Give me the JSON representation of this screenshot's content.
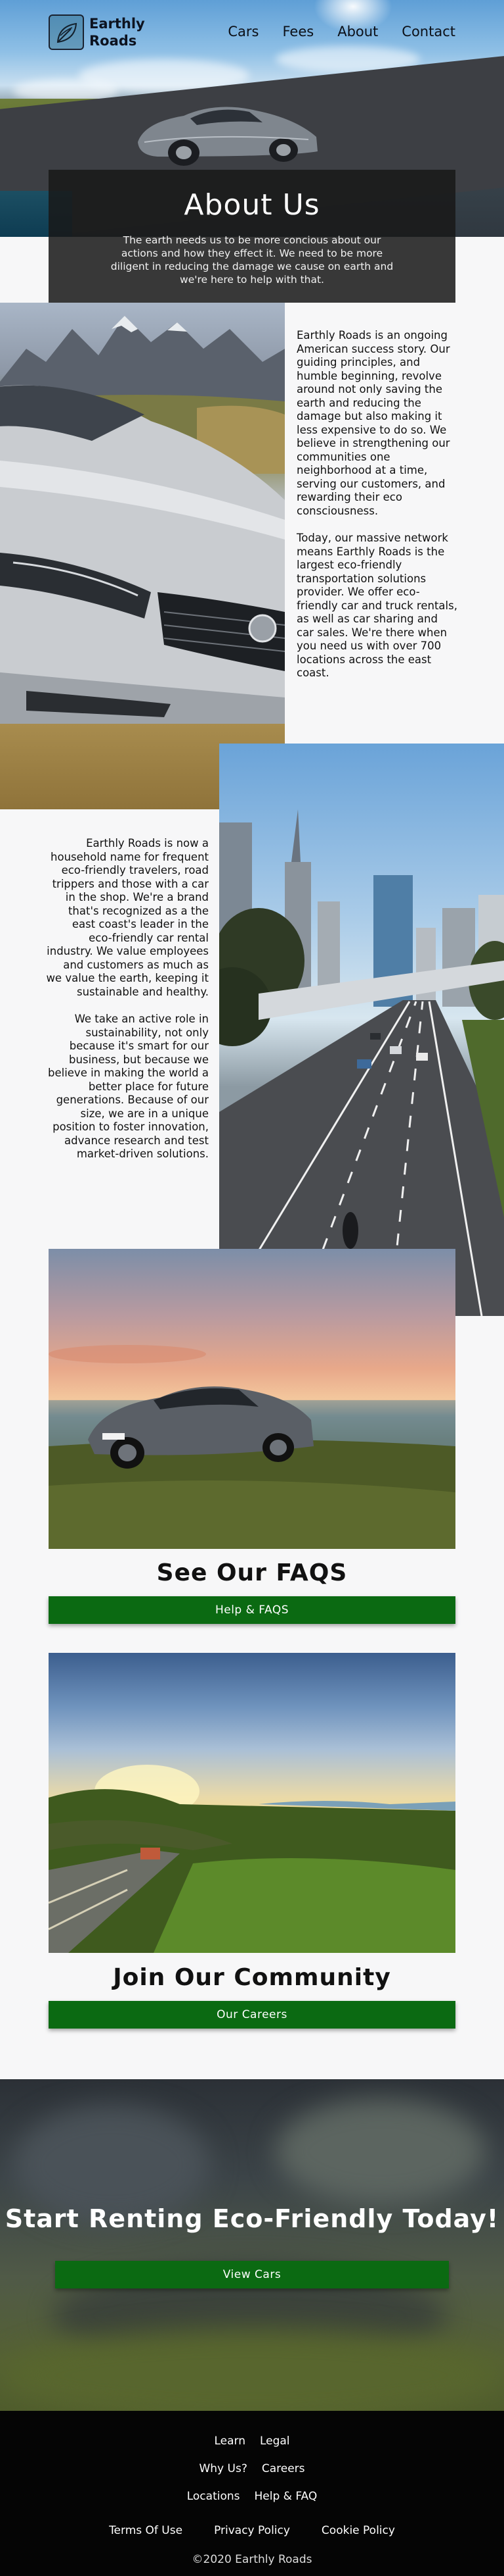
{
  "brand": {
    "name_line1": "Earthly",
    "name_line2": "Roads",
    "icon": "leaf-logo-icon"
  },
  "nav": {
    "links": [
      "Cars",
      "Fees",
      "About",
      "Contact"
    ]
  },
  "about": {
    "title": "About Us",
    "text": "The earth needs us to be more concious about our actions and how they effect it. We need to be more diligent in reducing the damage we cause on earth and we're here to help with that."
  },
  "section1": {
    "p1": "Earthly Roads is an ongoing American success story. Our guiding principles, and humble beginning, revolve around not only saving the earth and reducing the damage but also making it less expensive to do so. We believe in strengthening our communities one neighborhood at a time, serving our customers, and rewarding their eco consciousness.",
    "p2": "Today, our massive network means Earthly Roads is the largest eco-friendly transportation solutions provider. We offer eco-friendly car and truck rentals, as well as car sharing and car sales. We're there when you need us with over 700 locations across the east coast."
  },
  "section2": {
    "p1": "Earthly Roads is now a household name for frequent eco-friendly travelers, road trippers and those with a car in the shop. We're a brand that's recognized as a the east coast's leader in the eco-friendly car rental industry. We value employees and customers as much as we value the earth, keeping it sustainable and healthy.",
    "p2": "We take an active role in sustainability, not only because it's smart for our business, but because we believe in making the world a better place for future generations. Because of our size, we are in a unique position to foster innovation, advance research and test market-driven solutions."
  },
  "faq": {
    "heading": "See Our FAQS",
    "button": "Help & FAQS"
  },
  "community": {
    "heading": "Join Our Community",
    "button": "Our Careers"
  },
  "cta": {
    "heading": "Start Renting Eco-Friendly Today!",
    "button": "View Cars"
  },
  "footer": {
    "row1": [
      "Learn",
      "Legal"
    ],
    "row2": [
      "Why Us?",
      "Careers"
    ],
    "row3": [
      "Locations",
      "Help & FAQ"
    ],
    "row4": [
      "Terms Of Use",
      "Privacy Policy",
      "Cookie Policy"
    ],
    "copyright": "©2020 Earthly Roads"
  },
  "colors": {
    "accent_green": "#0b6a12",
    "footer_bg": "#050505",
    "about_overlay": "#181818"
  }
}
